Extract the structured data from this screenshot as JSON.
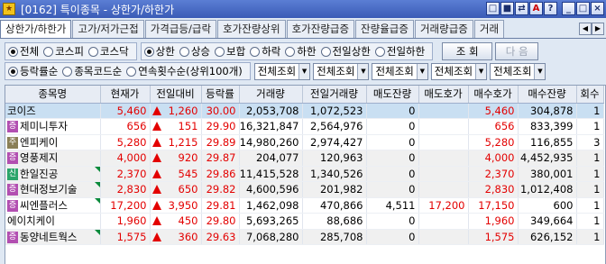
{
  "window": {
    "screen_code": "[0162]",
    "title": "특이종목 - 상한가/하한가",
    "app_icon_label": "★",
    "buttons": [
      "□",
      "■",
      "⇄",
      "A",
      "?",
      "_",
      "□",
      "×"
    ]
  },
  "tabs": [
    {
      "label": "상한가/하한가",
      "active": true
    },
    {
      "label": "고가/저가근접",
      "active": false
    },
    {
      "label": "가격급등/급락",
      "active": false
    },
    {
      "label": "호가잔량상위",
      "active": false
    },
    {
      "label": "호가잔량급증",
      "active": false
    },
    {
      "label": "잔량율급증",
      "active": false
    },
    {
      "label": "거래량급증",
      "active": false
    },
    {
      "label": "거래",
      "active": false
    }
  ],
  "tab_arrows": [
    "◀",
    "▶"
  ],
  "filters": {
    "market": [
      {
        "label": "전체",
        "selected": true
      },
      {
        "label": "코스피",
        "selected": false
      },
      {
        "label": "코스닥",
        "selected": false
      }
    ],
    "condition": [
      {
        "label": "상한",
        "selected": true
      },
      {
        "label": "상승",
        "selected": false
      },
      {
        "label": "보합",
        "selected": false
      },
      {
        "label": "하락",
        "selected": false
      },
      {
        "label": "하한",
        "selected": false
      },
      {
        "label": "전일상한",
        "selected": false
      },
      {
        "label": "전일하한",
        "selected": false
      }
    ],
    "sort": [
      {
        "label": "등락률순",
        "selected": true
      },
      {
        "label": "종목코드순",
        "selected": false
      },
      {
        "label": "연속횟수순(상위100개)",
        "selected": false
      }
    ],
    "dropdowns": [
      "전체조회",
      "전체조회",
      "전체조회",
      "전체조회",
      "전체조회"
    ],
    "search_button": "조 회",
    "next_button": "다 음"
  },
  "table": {
    "columns": [
      "종목명",
      "현재가",
      "전일대비",
      "등락률",
      "거래량",
      "전일거래량",
      "매도잔량",
      "매도호가",
      "매수호가",
      "매수잔량",
      "회수"
    ],
    "rows": [
      {
        "badge": "",
        "name": "코이즈",
        "price": "5,460",
        "change": "1,260",
        "rate": "30.00",
        "volume": "2,053,708",
        "prev_volume": "1,072,523",
        "ask_qty": "0",
        "ask": "",
        "bid": "5,460",
        "bid_qty": "304,878",
        "count": "1",
        "tri": false
      },
      {
        "badge": "증",
        "name": "제미니투자",
        "price": "656",
        "change": "151",
        "rate": "29.90",
        "volume": "16,321,847",
        "prev_volume": "2,564,976",
        "ask_qty": "0",
        "ask": "",
        "bid": "656",
        "bid_qty": "833,399",
        "count": "1",
        "tri": false
      },
      {
        "badge": "주",
        "name": "엔피케이",
        "price": "5,280",
        "change": "1,215",
        "rate": "29.89",
        "volume": "14,980,260",
        "prev_volume": "2,974,427",
        "ask_qty": "0",
        "ask": "",
        "bid": "5,280",
        "bid_qty": "116,855",
        "count": "3",
        "tri": false
      },
      {
        "badge": "증",
        "name": "영풍제지",
        "price": "4,000",
        "change": "920",
        "rate": "29.87",
        "volume": "204,077",
        "prev_volume": "120,963",
        "ask_qty": "0",
        "ask": "",
        "bid": "4,000",
        "bid_qty": "4,452,935",
        "count": "1",
        "tri": false
      },
      {
        "badge": "신",
        "name": "한일진공",
        "price": "2,370",
        "change": "545",
        "rate": "29.86",
        "volume": "11,415,528",
        "prev_volume": "1,340,526",
        "ask_qty": "0",
        "ask": "",
        "bid": "2,370",
        "bid_qty": "380,001",
        "count": "1",
        "tri": true
      },
      {
        "badge": "증",
        "name": "현대정보기술",
        "price": "2,830",
        "change": "650",
        "rate": "29.82",
        "volume": "4,600,596",
        "prev_volume": "201,982",
        "ask_qty": "0",
        "ask": "",
        "bid": "2,830",
        "bid_qty": "1,012,408",
        "count": "1",
        "tri": true
      },
      {
        "badge": "증",
        "name": "씨엔플러스",
        "price": "17,200",
        "change": "3,950",
        "rate": "29.81",
        "volume": "1,462,098",
        "prev_volume": "470,866",
        "ask_qty": "4,511",
        "ask": "17,200",
        "bid": "17,150",
        "bid_qty": "600",
        "count": "1",
        "tri": true
      },
      {
        "badge": "",
        "name": "에이치케이",
        "price": "1,960",
        "change": "450",
        "rate": "29.80",
        "volume": "5,693,265",
        "prev_volume": "88,686",
        "ask_qty": "0",
        "ask": "",
        "bid": "1,960",
        "bid_qty": "349,664",
        "count": "1",
        "tri": false
      },
      {
        "badge": "증",
        "name": "동양네트웍스",
        "price": "1,575",
        "change": "360",
        "rate": "29.63",
        "volume": "7,068,280",
        "prev_volume": "285,708",
        "ask_qty": "0",
        "ask": "",
        "bid": "1,575",
        "bid_qty": "626,152",
        "count": "1",
        "tri": true
      }
    ]
  },
  "colors": {
    "up": "#e30000",
    "selected_row": "#c9dff2",
    "badge_purple": "#b24fb1",
    "badge_green": "#2aa56b",
    "badge_olive": "#8a7f56"
  },
  "icons": {
    "change_up": "up-arrow-icon",
    "new_listing_mark": "green-corner-triangle-icon"
  }
}
